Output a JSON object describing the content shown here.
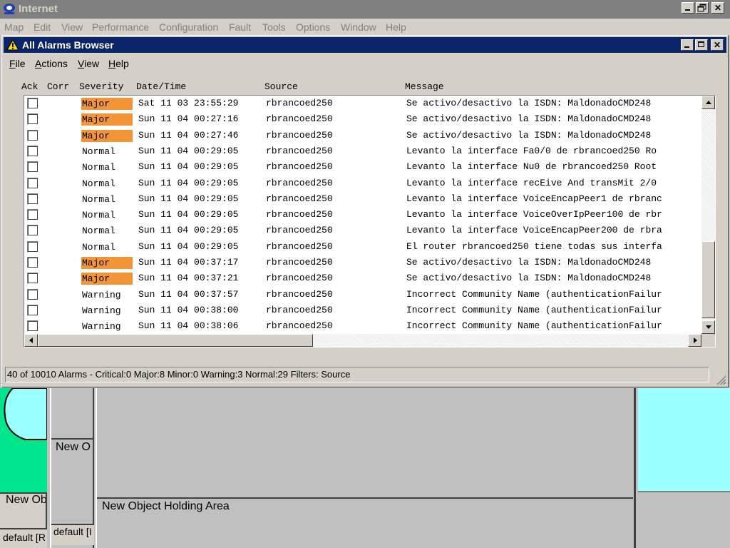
{
  "app": {
    "title": "Internet",
    "menu": [
      "Map",
      "Edit",
      "View",
      "Performance",
      "Configuration",
      "Fault",
      "Tools",
      "Options",
      "Window",
      "Help"
    ]
  },
  "browser": {
    "title": "All Alarms Browser",
    "menu": [
      "File",
      "Actions",
      "View",
      "Help"
    ],
    "columns": {
      "ack": "Ack",
      "corr": "Corr",
      "severity": "Severity",
      "datetime": "Date/Time",
      "source": "Source",
      "message": "Message"
    },
    "rows": [
      {
        "severity": "Major",
        "datetime": "Sat 11 03 23:55:29",
        "source": "rbrancoed250",
        "message": "Se activo/desactivo la ISDN: MaldonadoCMD248"
      },
      {
        "severity": "Major",
        "datetime": "Sun 11 04 00:27:16",
        "source": "rbrancoed250",
        "message": "Se activo/desactivo la ISDN: MaldonadoCMD248"
      },
      {
        "severity": "Major",
        "datetime": "Sun 11 04 00:27:46",
        "source": "rbrancoed250",
        "message": "Se activo/desactivo la ISDN: MaldonadoCMD248"
      },
      {
        "severity": "Normal",
        "datetime": "Sun 11 04 00:29:05",
        "source": "rbrancoed250",
        "message": "Levanto la interface Fa0/0 de rbrancoed250  Ro"
      },
      {
        "severity": "Normal",
        "datetime": "Sun 11 04 00:29:05",
        "source": "rbrancoed250",
        "message": "Levanto la interface Nu0 de rbrancoed250  Root"
      },
      {
        "severity": "Normal",
        "datetime": "Sun 11 04 00:29:05",
        "source": "rbrancoed250",
        "message": "Levanto la interface recEive And transMit 2/0"
      },
      {
        "severity": "Normal",
        "datetime": "Sun 11 04 00:29:05",
        "source": "rbrancoed250",
        "message": "Levanto la interface VoiceEncapPeer1 de rbranc"
      },
      {
        "severity": "Normal",
        "datetime": "Sun 11 04 00:29:05",
        "source": "rbrancoed250",
        "message": "Levanto la interface VoiceOverIpPeer100 de rbr"
      },
      {
        "severity": "Normal",
        "datetime": "Sun 11 04 00:29:05",
        "source": "rbrancoed250",
        "message": "Levanto la interface VoiceEncapPeer200 de rbra"
      },
      {
        "severity": "Normal",
        "datetime": "Sun 11 04 00:29:05",
        "source": "rbrancoed250",
        "message": "El router rbrancoed250 tiene todas sus interfa"
      },
      {
        "severity": "Major",
        "datetime": "Sun 11 04 00:37:17",
        "source": "rbrancoed250",
        "message": "Se activo/desactivo la ISDN: MaldonadoCMD248"
      },
      {
        "severity": "Major",
        "datetime": "Sun 11 04 00:37:21",
        "source": "rbrancoed250",
        "message": "Se activo/desactivo la ISDN: MaldonadoCMD248"
      },
      {
        "severity": "Warning",
        "datetime": "Sun 11 04 00:37:57",
        "source": "rbrancoed250",
        "message": "Incorrect Community Name (authenticationFailur"
      },
      {
        "severity": "Warning",
        "datetime": "Sun 11 04 00:38:00",
        "source": "rbrancoed250",
        "message": "Incorrect Community Name (authenticationFailur"
      },
      {
        "severity": "Warning",
        "datetime": "Sun 11 04 00:38:06",
        "source": "rbrancoed250",
        "message": "Incorrect Community Name (authenticationFailur"
      }
    ],
    "status": "40 of 10010 Alarms -  Critical:0  Major:8  Minor:0  Warning:3  Normal:29   Filters: Source"
  },
  "background": {
    "pane1_label": "New Ob",
    "pane1_status": "default [R",
    "pane2_label": "New O",
    "pane2_status": "default [I",
    "holding_area_label": "New Object Holding Area"
  },
  "colors": {
    "major": "#f28c28",
    "child_title": "#0a246a",
    "app_title": "#808080",
    "map_green": "#00e68c",
    "map_cyan": "#99ffff"
  }
}
